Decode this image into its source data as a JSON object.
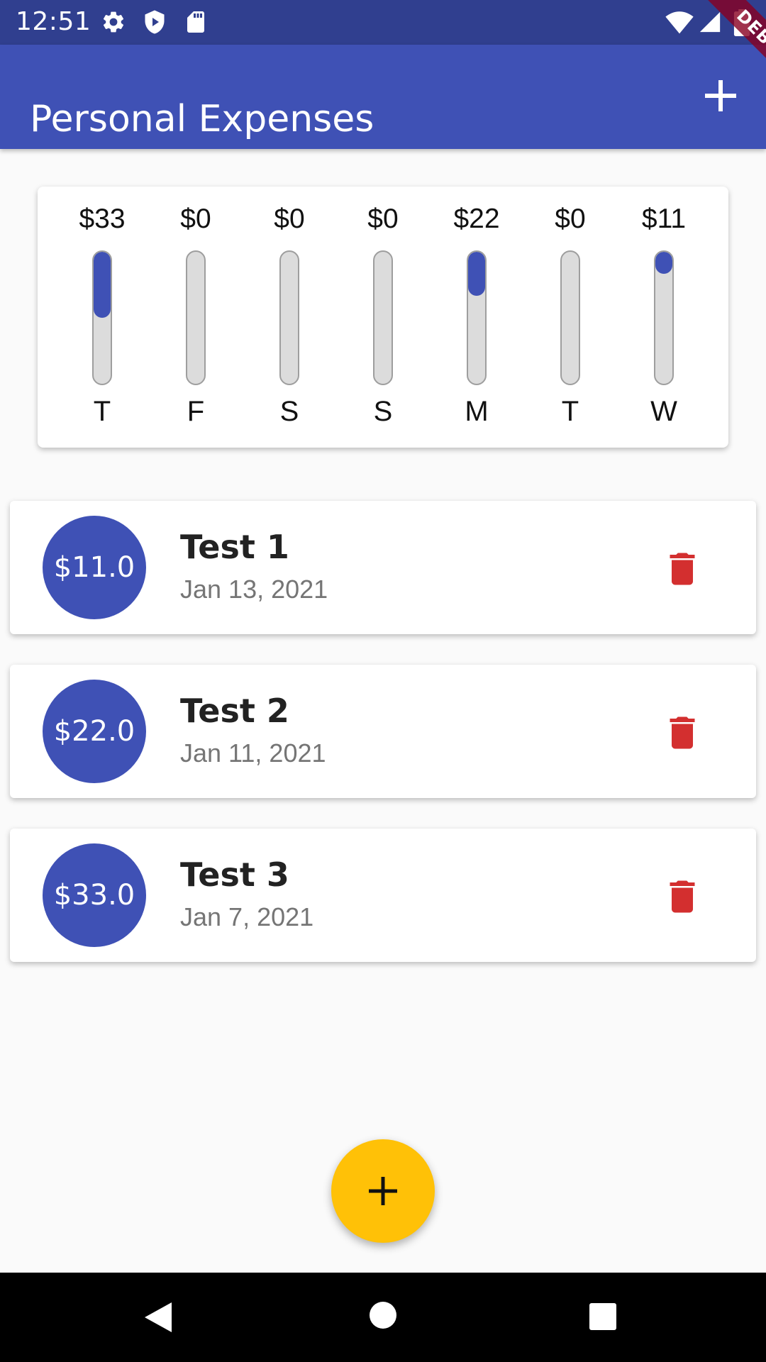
{
  "status_bar": {
    "time": "12:51",
    "icons": [
      "gear-icon",
      "shield-play-icon",
      "sd-card-icon",
      "wifi-icon",
      "signal-icon",
      "battery-icon"
    ]
  },
  "debug_banner": "DEBUG",
  "app_bar": {
    "title": "Personal Expenses",
    "action_icon": "plus-icon"
  },
  "chart": {
    "bar_color": "#3f51b5",
    "days": [
      {
        "amount": "$33",
        "day": "T",
        "fraction": 0.5
      },
      {
        "amount": "$0",
        "day": "F",
        "fraction": 0
      },
      {
        "amount": "$0",
        "day": "S",
        "fraction": 0
      },
      {
        "amount": "$0",
        "day": "S",
        "fraction": 0
      },
      {
        "amount": "$22",
        "day": "M",
        "fraction": 0.333
      },
      {
        "amount": "$0",
        "day": "T",
        "fraction": 0
      },
      {
        "amount": "$11",
        "day": "W",
        "fraction": 0.167
      }
    ]
  },
  "transactions": [
    {
      "amount": "$11.0",
      "title": "Test 1",
      "date": "Jan 13, 2021"
    },
    {
      "amount": "$22.0",
      "title": "Test 2",
      "date": "Jan 11, 2021"
    },
    {
      "amount": "$33.0",
      "title": "Test 3",
      "date": "Jan 7, 2021"
    }
  ],
  "delete_icon": "trash-icon",
  "delete_color": "#d32f2f",
  "fab": {
    "icon": "plus-icon",
    "color": "#ffc107"
  },
  "nav_bar": {
    "icons": [
      "back-triangle-icon",
      "home-circle-icon",
      "recents-square-icon"
    ]
  }
}
